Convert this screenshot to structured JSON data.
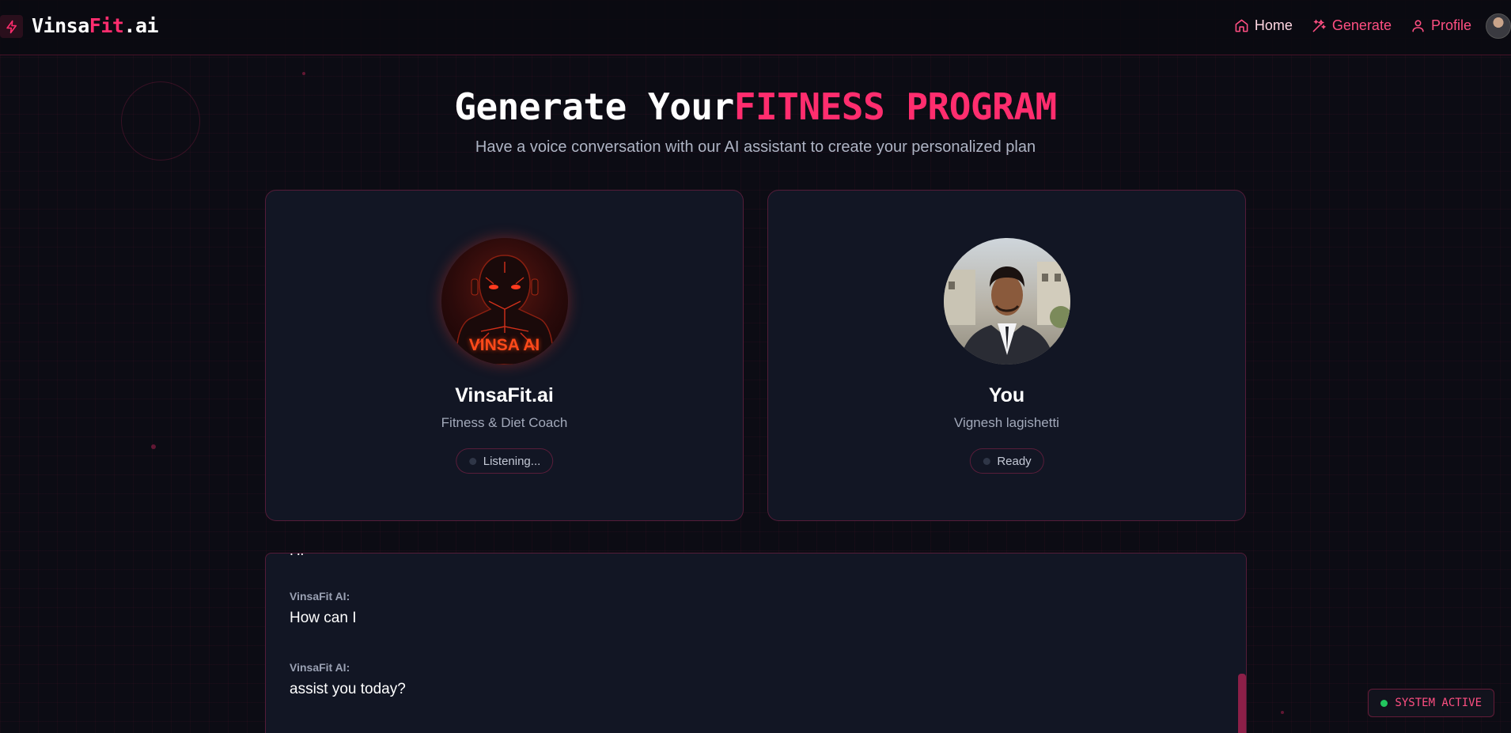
{
  "header": {
    "logo_part1": "Vinsa",
    "logo_part2": "Fit",
    "logo_part3": ".ai",
    "nav": [
      {
        "label": "Home",
        "icon": "home-icon"
      },
      {
        "label": "Generate",
        "icon": "generate-icon"
      },
      {
        "label": "Profile",
        "icon": "user-icon"
      }
    ]
  },
  "page": {
    "title_part1": "Generate Your",
    "title_part2": "FITNESS PROGRAM",
    "subtitle": "Have a voice conversation with our AI assistant to create your personalized plan"
  },
  "ai_card": {
    "avatar_text": "VINSA AI",
    "name": "VinsaFit.ai",
    "role": "Fitness & Diet Coach",
    "status": "Listening..."
  },
  "user_card": {
    "name": "You",
    "role": "Vignesh lagishetti",
    "status": "Ready"
  },
  "transcript": {
    "partial_top": "Hi",
    "messages": [
      {
        "speaker": "VinsaFit AI:",
        "text": "How can I"
      },
      {
        "speaker": "VinsaFit AI:",
        "text": "assist you today?"
      }
    ]
  },
  "system": {
    "status": "SYSTEM ACTIVE"
  },
  "colors": {
    "accent": "#ff2d6e",
    "background": "#0c0c14",
    "card": "#121624",
    "active_dot": "#22c55e"
  }
}
